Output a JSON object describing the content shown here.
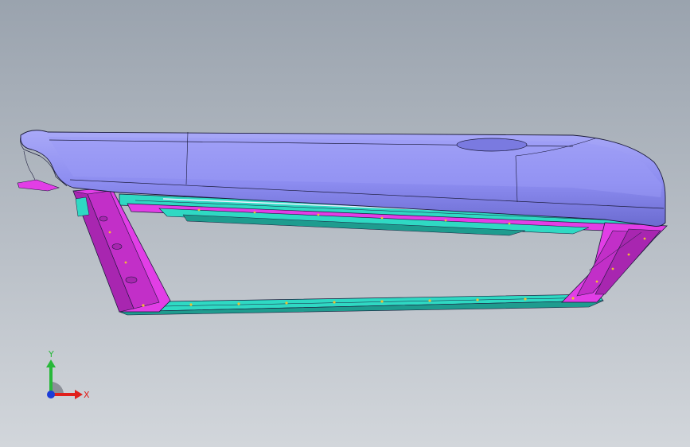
{
  "viewport": {
    "background_top": "#9aa3ae",
    "background_bottom": "#d2d6db"
  },
  "model": {
    "body_color": "#8c8cf0",
    "body_shade": "#6f6fd6",
    "frame_color": "#e23ee6",
    "frame_shade": "#a826b0",
    "rail_color": "#2fd9c3",
    "rail_shade": "#1e9c8f",
    "edge_color": "#1a1a3a",
    "hole_color": "#f0c030"
  },
  "triad": {
    "x_label": "X",
    "y_label": "Y",
    "x_color": "#e0201c",
    "y_color": "#28b83a",
    "z_color": "#1c3cd8",
    "icons": [
      "x-axis-arrow-icon",
      "y-axis-arrow-icon",
      "z-axis-dot-icon"
    ]
  }
}
